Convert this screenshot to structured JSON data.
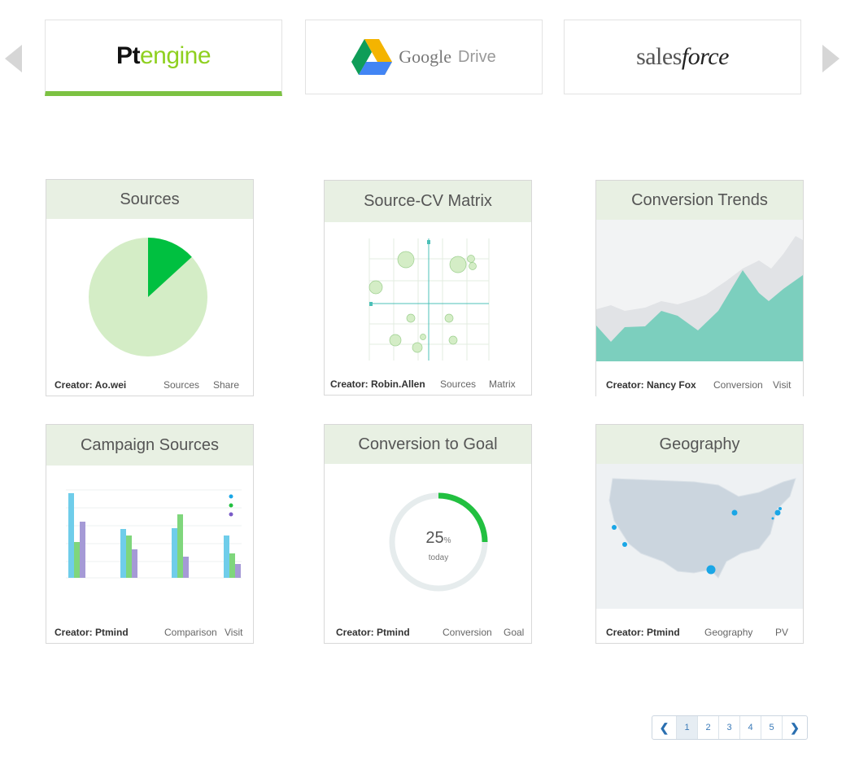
{
  "carousel": {
    "logos": [
      {
        "part1": "Pt",
        "part2": "engine"
      },
      {
        "word": "Google",
        "product": "Drive"
      },
      {
        "prefix": "sales",
        "suffix": "force"
      }
    ],
    "active_color": "#7cc242"
  },
  "cards": [
    {
      "title": "Sources",
      "creator": "Creator: Ao.wei",
      "tags": [
        "Sources",
        "Share"
      ]
    },
    {
      "title": "Source-CV Matrix",
      "creator": "Creator: Robin.Allen",
      "tags": [
        "Sources",
        "Matrix"
      ]
    },
    {
      "title": "Conversion Trends",
      "creator": "Creator: Nancy Fox",
      "tags": [
        "Conversion",
        "Visit"
      ]
    },
    {
      "title": "Campaign Sources",
      "creator": "Creator: Ptmind",
      "tags": [
        "Comparison",
        "Visit"
      ]
    },
    {
      "title": "Conversion to Goal",
      "creator": "Creator: Ptmind",
      "tags": [
        "Conversion",
        "Goal"
      ]
    },
    {
      "title": "Geography",
      "creator": "Creator: Ptmind",
      "tags": [
        "Geography",
        "PV"
      ]
    }
  ],
  "goal": {
    "value": "25",
    "unit": "%",
    "label": "today"
  },
  "pagination": {
    "pages": [
      "1",
      "2",
      "3",
      "4",
      "5"
    ],
    "current": "1"
  },
  "colors": {
    "header_bg": "#e8f0e3",
    "pie_main": "#d4edc6",
    "pie_slice": "#00c040",
    "teal": "#7ccfbe",
    "gauge": "#22c040",
    "map_dot": "#1aa6e6"
  }
}
